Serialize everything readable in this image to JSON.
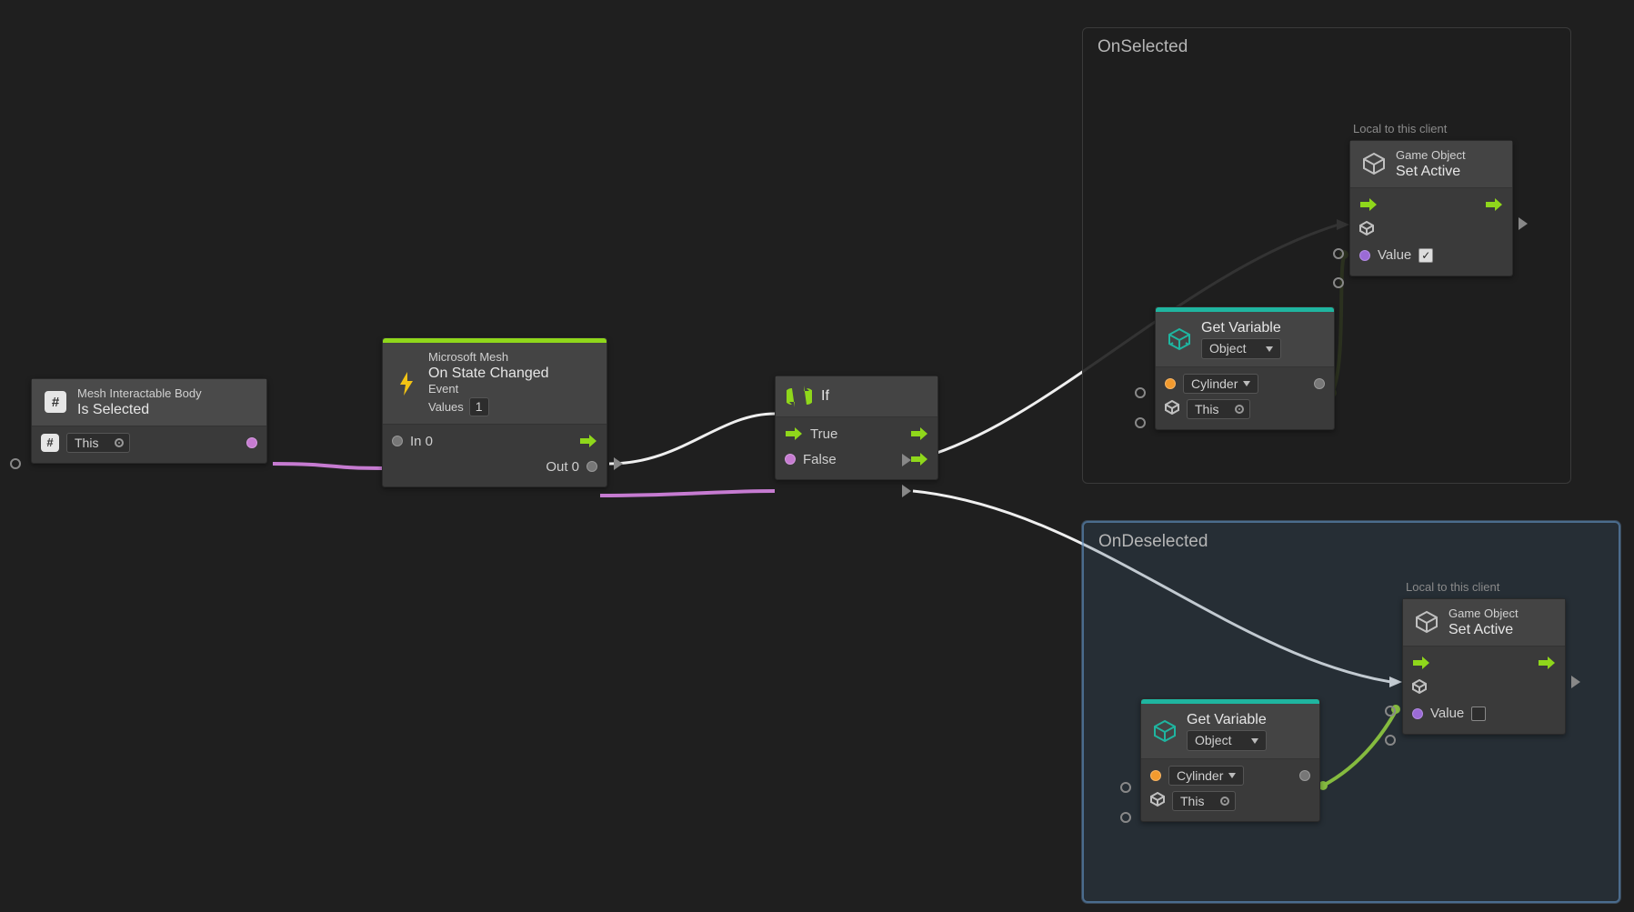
{
  "nodes": {
    "isSelected": {
      "category": "Mesh Interactable Body",
      "title": "Is Selected",
      "targetField": "This"
    },
    "onStateChanged": {
      "category": "Microsoft Mesh",
      "title": "On State Changed",
      "subtitle": "Event",
      "valuesLabel": "Values",
      "valuesCount": "1",
      "in0": "In 0",
      "out0": "Out 0"
    },
    "ifNode": {
      "title": "If",
      "trueLabel": "True",
      "falseLabel": "False"
    },
    "getVar1": {
      "title": "Get Variable",
      "scope": "Object",
      "varName": "Cylinder",
      "target": "This"
    },
    "getVar2": {
      "title": "Get Variable",
      "scope": "Object",
      "varName": "Cylinder",
      "target": "This"
    },
    "setActive1": {
      "hint": "Local to this client",
      "category": "Game Object",
      "title": "Set Active",
      "valueLabel": "Value",
      "valueChecked": true
    },
    "setActive2": {
      "hint": "Local to this client",
      "category": "Game Object",
      "title": "Set Active",
      "valueLabel": "Value",
      "valueChecked": false
    }
  },
  "groups": {
    "onSelected": {
      "title": "OnSelected"
    },
    "onDeselected": {
      "title": "OnDeselected"
    }
  }
}
